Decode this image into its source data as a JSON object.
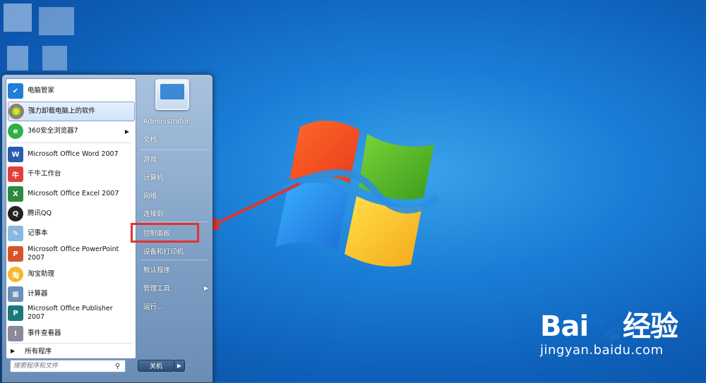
{
  "start_menu": {
    "programs": [
      {
        "label": "电脑管家",
        "icon": "tencent-pc-manager-icon"
      },
      {
        "label": "强力卸载电脑上的软件",
        "icon": "uninstall-flower-icon"
      },
      {
        "label": "360安全浏览器7",
        "icon": "360-browser-icon"
      },
      {
        "label": "Microsoft Office Word 2007",
        "icon": "word-icon"
      },
      {
        "label": "千牛工作台",
        "icon": "qianniu-icon"
      },
      {
        "label": "Microsoft Office Excel 2007",
        "icon": "excel-icon"
      },
      {
        "label": "腾讯QQ",
        "icon": "qq-penguin-icon"
      },
      {
        "label": "记事本",
        "icon": "notepad-icon"
      },
      {
        "label": "Microsoft Office PowerPoint 2007",
        "icon": "powerpoint-icon"
      },
      {
        "label": "淘宝助理",
        "icon": "taobao-helper-icon"
      },
      {
        "label": "计算器",
        "icon": "calculator-icon"
      },
      {
        "label": "Microsoft Office Publisher 2007",
        "icon": "publisher-icon"
      },
      {
        "label": "事件查看器",
        "icon": "event-viewer-icon"
      }
    ],
    "all_programs": "所有程序",
    "search_placeholder": "搜索程序和文件",
    "right_items": [
      {
        "label": "Administrator"
      },
      {
        "label": "文档"
      },
      {
        "label": "游戏"
      },
      {
        "label": "计算机"
      },
      {
        "label": "网络"
      },
      {
        "label": "连接到"
      },
      {
        "label": "控制面板"
      },
      {
        "label": "设备和打印机"
      },
      {
        "label": "默认程序"
      },
      {
        "label": "管理工具"
      },
      {
        "label": "运行..."
      }
    ],
    "shutdown_label": "关机"
  },
  "watermark": {
    "brand": "Bai",
    "brand_suffix": "经验",
    "url": "jingyan.baidu.com"
  },
  "colors": {
    "highlight": "#e5322c",
    "desktop": "#1a7ed6"
  }
}
